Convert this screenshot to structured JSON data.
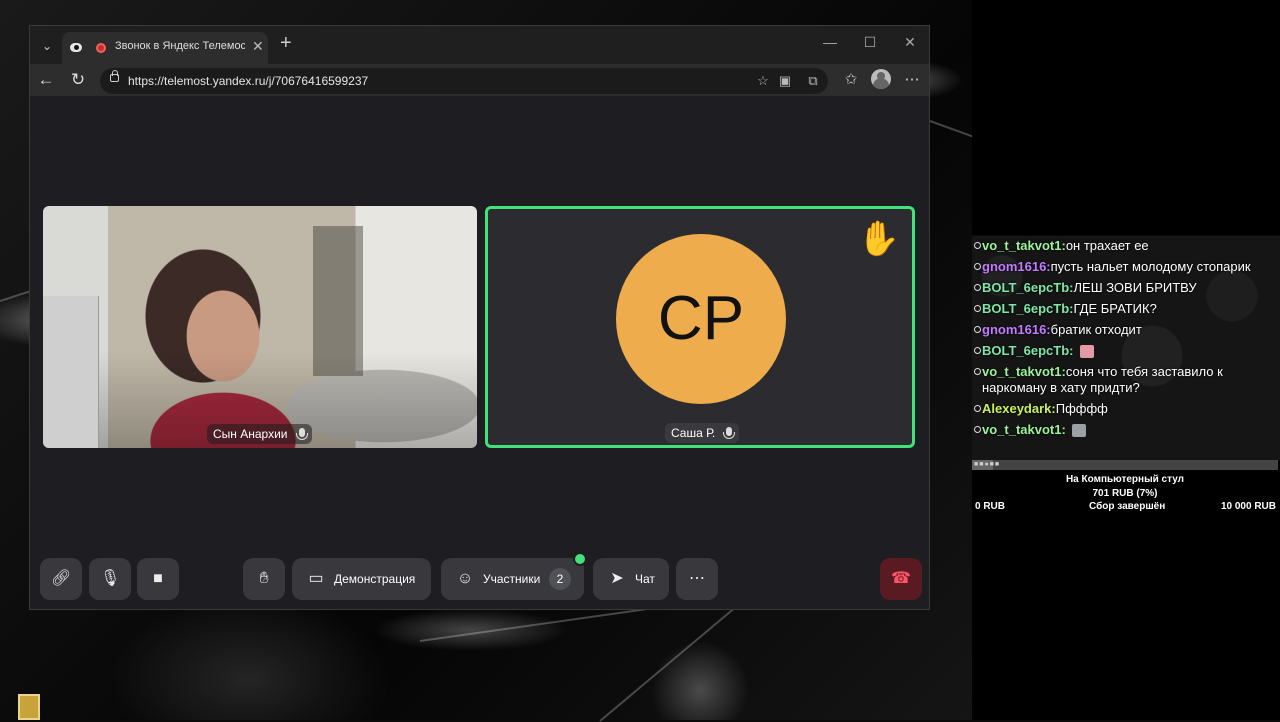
{
  "browser": {
    "tab_title": "Звонок в Яндекс Телемосте",
    "url": "https://telemost.yandex.ru/j/70676416599237"
  },
  "call": {
    "participants": [
      {
        "name": "Сын Анархии",
        "type": "video"
      },
      {
        "name": "Саша Р.",
        "type": "avatar",
        "initials": "СР",
        "avatar_color": "#efac4c",
        "raised_hand": true,
        "active_speaker_color": "#41e27b"
      }
    ],
    "controls": {
      "demo_label": "Демонстрация",
      "participants_label": "Участники",
      "participants_count": "2",
      "chat_label": "Чат"
    }
  },
  "chat": {
    "messages": [
      {
        "nick": "vo_t_takvot1:",
        "text": "он трахает ее",
        "color": "#9cf29a"
      },
      {
        "nick": "gnom1616:",
        "text": "пусть нальет молодому стопарик",
        "color": "#c27bff"
      },
      {
        "nick": "BOLT_6ерсТb:",
        "text": "ЛЕШ ЗОВИ БРИТВУ",
        "color": "#7ee6a8"
      },
      {
        "nick": "BOLT_6ерсТb:",
        "text": "ГДЕ БРАТИК?",
        "color": "#7ee6a8"
      },
      {
        "nick": "gnom1616:",
        "text": "братик отходит",
        "color": "#c27bff"
      },
      {
        "nick": "BOLT_6ерсТb:",
        "text": "",
        "color": "#7ee6a8",
        "emote": "pink"
      },
      {
        "nick": "vo_t_takvot1:",
        "text": "соня что тебя заставило к наркоману в хату придти?",
        "color": "#9cf29a"
      },
      {
        "nick": "Alexeydark:",
        "text": "Пфффф",
        "color": "#c9f25a"
      },
      {
        "nick": "vo_t_takvot1:",
        "text": "",
        "color": "#9cf29a",
        "emote": "grey"
      }
    ]
  },
  "goal": {
    "title": "На Компьютерный стул",
    "amount": "701 RUB (7%)",
    "progress_percent": 7,
    "min": "0 RUB",
    "status": "Сбор завершён",
    "max": "10 000 RUB"
  }
}
